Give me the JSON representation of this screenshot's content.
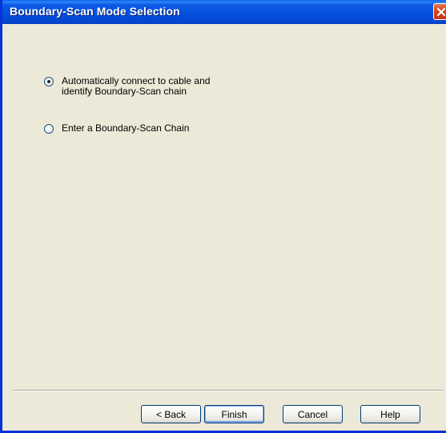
{
  "window": {
    "title": "Boundary-Scan Mode Selection",
    "close_icon": "close-icon"
  },
  "options": [
    {
      "line1": "Automatically connect to cable and",
      "line2": "identify Boundary-Scan chain",
      "selected": true
    },
    {
      "line1": "Enter a Boundary-Scan Chain",
      "line2": "",
      "selected": false
    }
  ],
  "buttons": {
    "back_label": "< Back",
    "finish_label": "Finish",
    "cancel_label": "Cancel",
    "help_label": "Help"
  },
  "colors": {
    "titlebar": "#0553e0",
    "dialog_bg": "#ece9d8",
    "close_button": "#d6431c"
  }
}
